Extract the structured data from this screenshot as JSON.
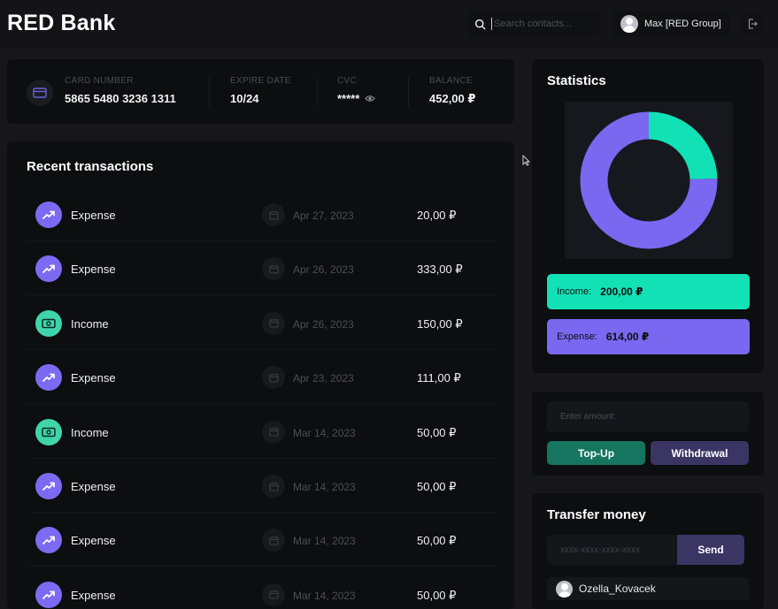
{
  "header": {
    "logo": "RED Bank",
    "search_placeholder": "Search contacts...",
    "user_name": "Max [RED Group]",
    "icons": {
      "search": "search-icon",
      "user": "avatar",
      "logout": "logout-icon"
    }
  },
  "card": {
    "number_label": "CARD NUMBER",
    "number": "5865 5480 3236 1311",
    "expire_label": "EXPIRE DATE",
    "expire": "10/24",
    "cvc_label": "CVC",
    "cvc": "*****",
    "balance_label": "BALANCE",
    "balance": "452,00 ₽"
  },
  "transactions": {
    "title": "Recent transactions",
    "rows": [
      {
        "type": "Expense",
        "date": "Apr 27, 2023",
        "amount": "20,00 ₽"
      },
      {
        "type": "Expense",
        "date": "Apr 26, 2023",
        "amount": "333,00 ₽"
      },
      {
        "type": "Income",
        "date": "Apr 26, 2023",
        "amount": "150,00 ₽"
      },
      {
        "type": "Expense",
        "date": "Apr 23, 2023",
        "amount": "111,00 ₽"
      },
      {
        "type": "Income",
        "date": "Mar 14, 2023",
        "amount": "50,00 ₽"
      },
      {
        "type": "Expense",
        "date": "Mar 14, 2023",
        "amount": "50,00 ₽"
      },
      {
        "type": "Expense",
        "date": "Mar 14, 2023",
        "amount": "50,00 ₽"
      },
      {
        "type": "Expense",
        "date": "Mar 14, 2023",
        "amount": "50,00 ₽"
      }
    ]
  },
  "statistics": {
    "title": "Statistics",
    "income_label": "Income:",
    "income_value": "200,00 ₽",
    "expense_label": "Expense:",
    "expense_value": "614,00 ₽",
    "donut": {
      "income": 200,
      "expense": 614,
      "income_color": "#12e1b6",
      "expense_color": "#7a68f0"
    }
  },
  "amount": {
    "placeholder": "Enter amount:",
    "topup_label": "Top-Up",
    "withdraw_label": "Withdrawal"
  },
  "transfer": {
    "title": "Transfer money",
    "placeholder": "xxxx-xxxx-xxxx-xxxx",
    "send_label": "Send",
    "contact_name": "Ozella_Kovacek"
  },
  "colors": {
    "background": "#17171b",
    "panel": "#0c0e0f",
    "income": "#12e1b6",
    "expense": "#7a68f0",
    "topup": "#16755f",
    "withdraw": "#3b3564"
  }
}
